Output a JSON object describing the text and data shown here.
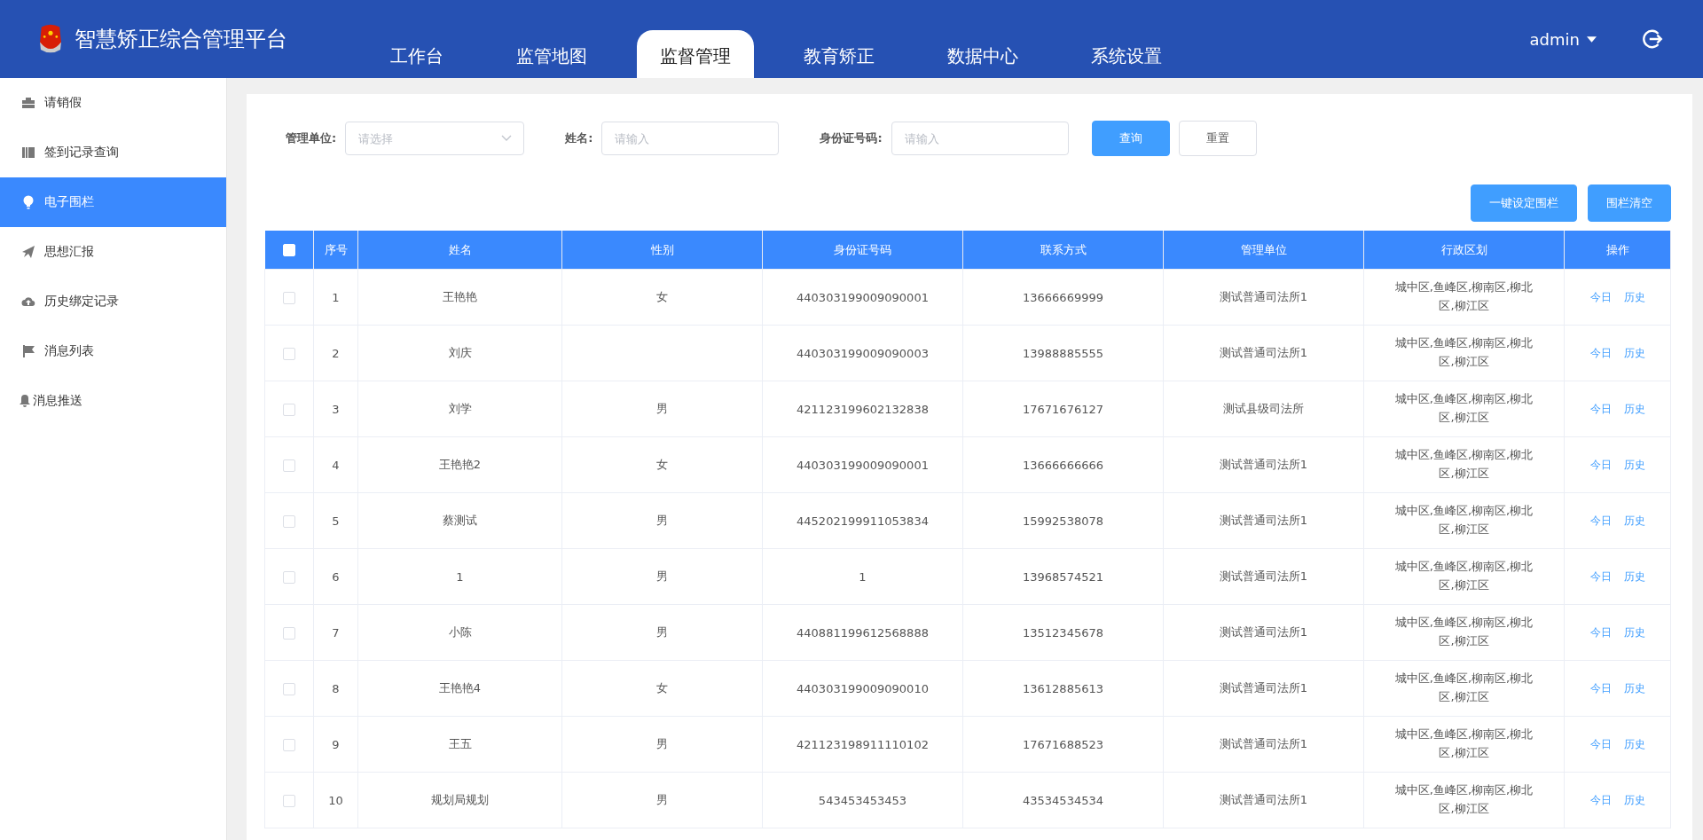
{
  "header": {
    "title": "智慧矫正综合管理平台",
    "user": "admin"
  },
  "nav": [
    {
      "label": "工作台",
      "selected": false
    },
    {
      "label": "监管地图",
      "selected": false
    },
    {
      "label": "监督管理",
      "selected": true
    },
    {
      "label": "教育矫正",
      "selected": false
    },
    {
      "label": "数据中心",
      "selected": false
    },
    {
      "label": "系统设置",
      "selected": false
    }
  ],
  "sidebar": {
    "items": [
      {
        "label": "请销假",
        "kind": "briefcase",
        "selected": false
      },
      {
        "label": "签到记录查询",
        "kind": "books",
        "selected": false
      },
      {
        "label": "电子围栏",
        "kind": "bulb",
        "selected": true
      },
      {
        "label": "思想汇报",
        "kind": "plane",
        "selected": false
      },
      {
        "label": "历史绑定记录",
        "kind": "cloud",
        "selected": false
      },
      {
        "label": "消息列表",
        "kind": "flag",
        "selected": false
      },
      {
        "label": "消息推送",
        "kind": "bell",
        "selected": false
      }
    ]
  },
  "filters": [
    {
      "label": "管理单位:",
      "kind": "select",
      "placeholder": "请选择"
    },
    {
      "label": "姓名:",
      "kind": "input",
      "placeholder": "请输入"
    },
    {
      "label": "身份证号码:",
      "kind": "input",
      "placeholder": "请输入"
    }
  ],
  "filter_buttons": [
    {
      "label": "查询",
      "kind": "primary"
    },
    {
      "label": "重置",
      "kind": "plain"
    }
  ],
  "actions": [
    "一键设定围栏",
    "围栏清空"
  ],
  "table": {
    "all_checked": false,
    "columns": [
      "序号",
      "姓名",
      "性别",
      "身份证号码",
      "联系方式",
      "管理单位",
      "行政区划",
      "操作"
    ],
    "rows": [
      {
        "checked": false,
        "cells": [
          "1",
          "王艳艳",
          "女",
          "440303199009090001",
          "13666669999",
          "测试普通司法所1",
          "城中区,鱼峰区,柳南区,柳北区,柳江区"
        ],
        "links": [
          "今日",
          "历史"
        ]
      },
      {
        "checked": false,
        "cells": [
          "2",
          "刘庆",
          "",
          "440303199009090003",
          "13988885555",
          "测试普通司法所1",
          "城中区,鱼峰区,柳南区,柳北区,柳江区"
        ],
        "links": [
          "今日",
          "历史"
        ]
      },
      {
        "checked": false,
        "cells": [
          "3",
          "刘学",
          "男",
          "421123199602132838",
          "17671676127",
          "测试县级司法所",
          "城中区,鱼峰区,柳南区,柳北区,柳江区"
        ],
        "links": [
          "今日",
          "历史"
        ]
      },
      {
        "checked": false,
        "cells": [
          "4",
          "王艳艳2",
          "女",
          "440303199009090001",
          "13666666666",
          "测试普通司法所1",
          "城中区,鱼峰区,柳南区,柳北区,柳江区"
        ],
        "links": [
          "今日",
          "历史"
        ]
      },
      {
        "checked": false,
        "cells": [
          "5",
          "蔡测试",
          "男",
          "445202199911053834",
          "15992538078",
          "测试普通司法所1",
          "城中区,鱼峰区,柳南区,柳北区,柳江区"
        ],
        "links": [
          "今日",
          "历史"
        ]
      },
      {
        "checked": false,
        "cells": [
          "6",
          "1",
          "男",
          "1",
          "13968574521",
          "测试普通司法所1",
          "城中区,鱼峰区,柳南区,柳北区,柳江区"
        ],
        "links": [
          "今日",
          "历史"
        ]
      },
      {
        "checked": false,
        "cells": [
          "7",
          "小陈",
          "男",
          "440881199612568888",
          "13512345678",
          "测试普通司法所1",
          "城中区,鱼峰区,柳南区,柳北区,柳江区"
        ],
        "links": [
          "今日",
          "历史"
        ]
      },
      {
        "checked": false,
        "cells": [
          "8",
          "王艳艳4",
          "女",
          "440303199009090010",
          "13612885613",
          "测试普通司法所1",
          "城中区,鱼峰区,柳南区,柳北区,柳江区"
        ],
        "links": [
          "今日",
          "历史"
        ]
      },
      {
        "checked": false,
        "cells": [
          "9",
          "王五",
          "男",
          "421123198911110102",
          "17671688523",
          "测试普通司法所1",
          "城中区,鱼峰区,柳南区,柳北区,柳江区"
        ],
        "links": [
          "今日",
          "历史"
        ]
      },
      {
        "checked": false,
        "cells": [
          "10",
          "规划局规划",
          "男",
          "543453453453",
          "43534534534",
          "测试普通司法所1",
          "城中区,鱼峰区,柳南区,柳北区,柳江区"
        ],
        "links": [
          "今日",
          "历史"
        ]
      }
    ]
  }
}
